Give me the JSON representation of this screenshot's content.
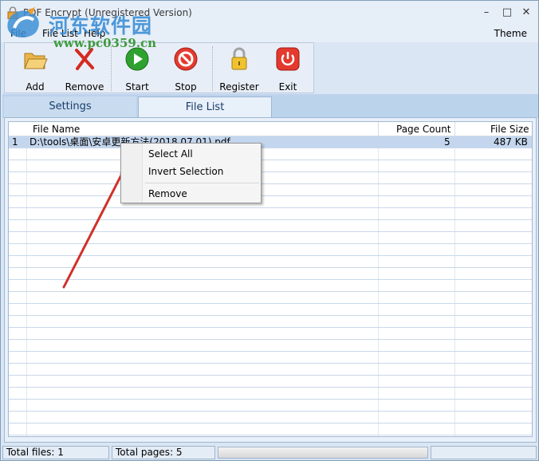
{
  "window": {
    "title": "PDF Encrypt (Unregistered Version)",
    "controls": {
      "minimize": "–",
      "maximize": "□",
      "close": "✕"
    }
  },
  "watermark": {
    "text_cn": "河东软件园",
    "url": "www.pc0359.cn"
  },
  "menu": {
    "items": [
      "File",
      "File List",
      "Help"
    ],
    "theme": "Theme"
  },
  "toolbar": {
    "buttons": [
      {
        "label": "Add",
        "icon": "folder-open-icon"
      },
      {
        "label": "Remove",
        "icon": "red-x-icon"
      },
      {
        "label": "Start",
        "icon": "play-icon"
      },
      {
        "label": "Stop",
        "icon": "stop-icon"
      },
      {
        "label": "Register",
        "icon": "padlock-icon"
      },
      {
        "label": "Exit",
        "icon": "power-icon"
      }
    ]
  },
  "tabs": {
    "settings": "Settings",
    "file_list": "File List",
    "active": "File List"
  },
  "list": {
    "columns": [
      "File Name",
      "Page Count",
      "File Size"
    ],
    "rows": [
      {
        "index": "1",
        "file_name": "D:\\tools\\桌面\\安卓更新方法(2018.07.01).pdf",
        "page_count": "5",
        "file_size": "487 KB"
      }
    ]
  },
  "context_menu": {
    "items": [
      "Select All",
      "Invert Selection",
      "Remove"
    ]
  },
  "status": {
    "total_files": "Total files: 1",
    "total_pages": "Total pages: 5"
  },
  "colors": {
    "accent": "#c3d6ee",
    "arrow": "#d0302a"
  }
}
